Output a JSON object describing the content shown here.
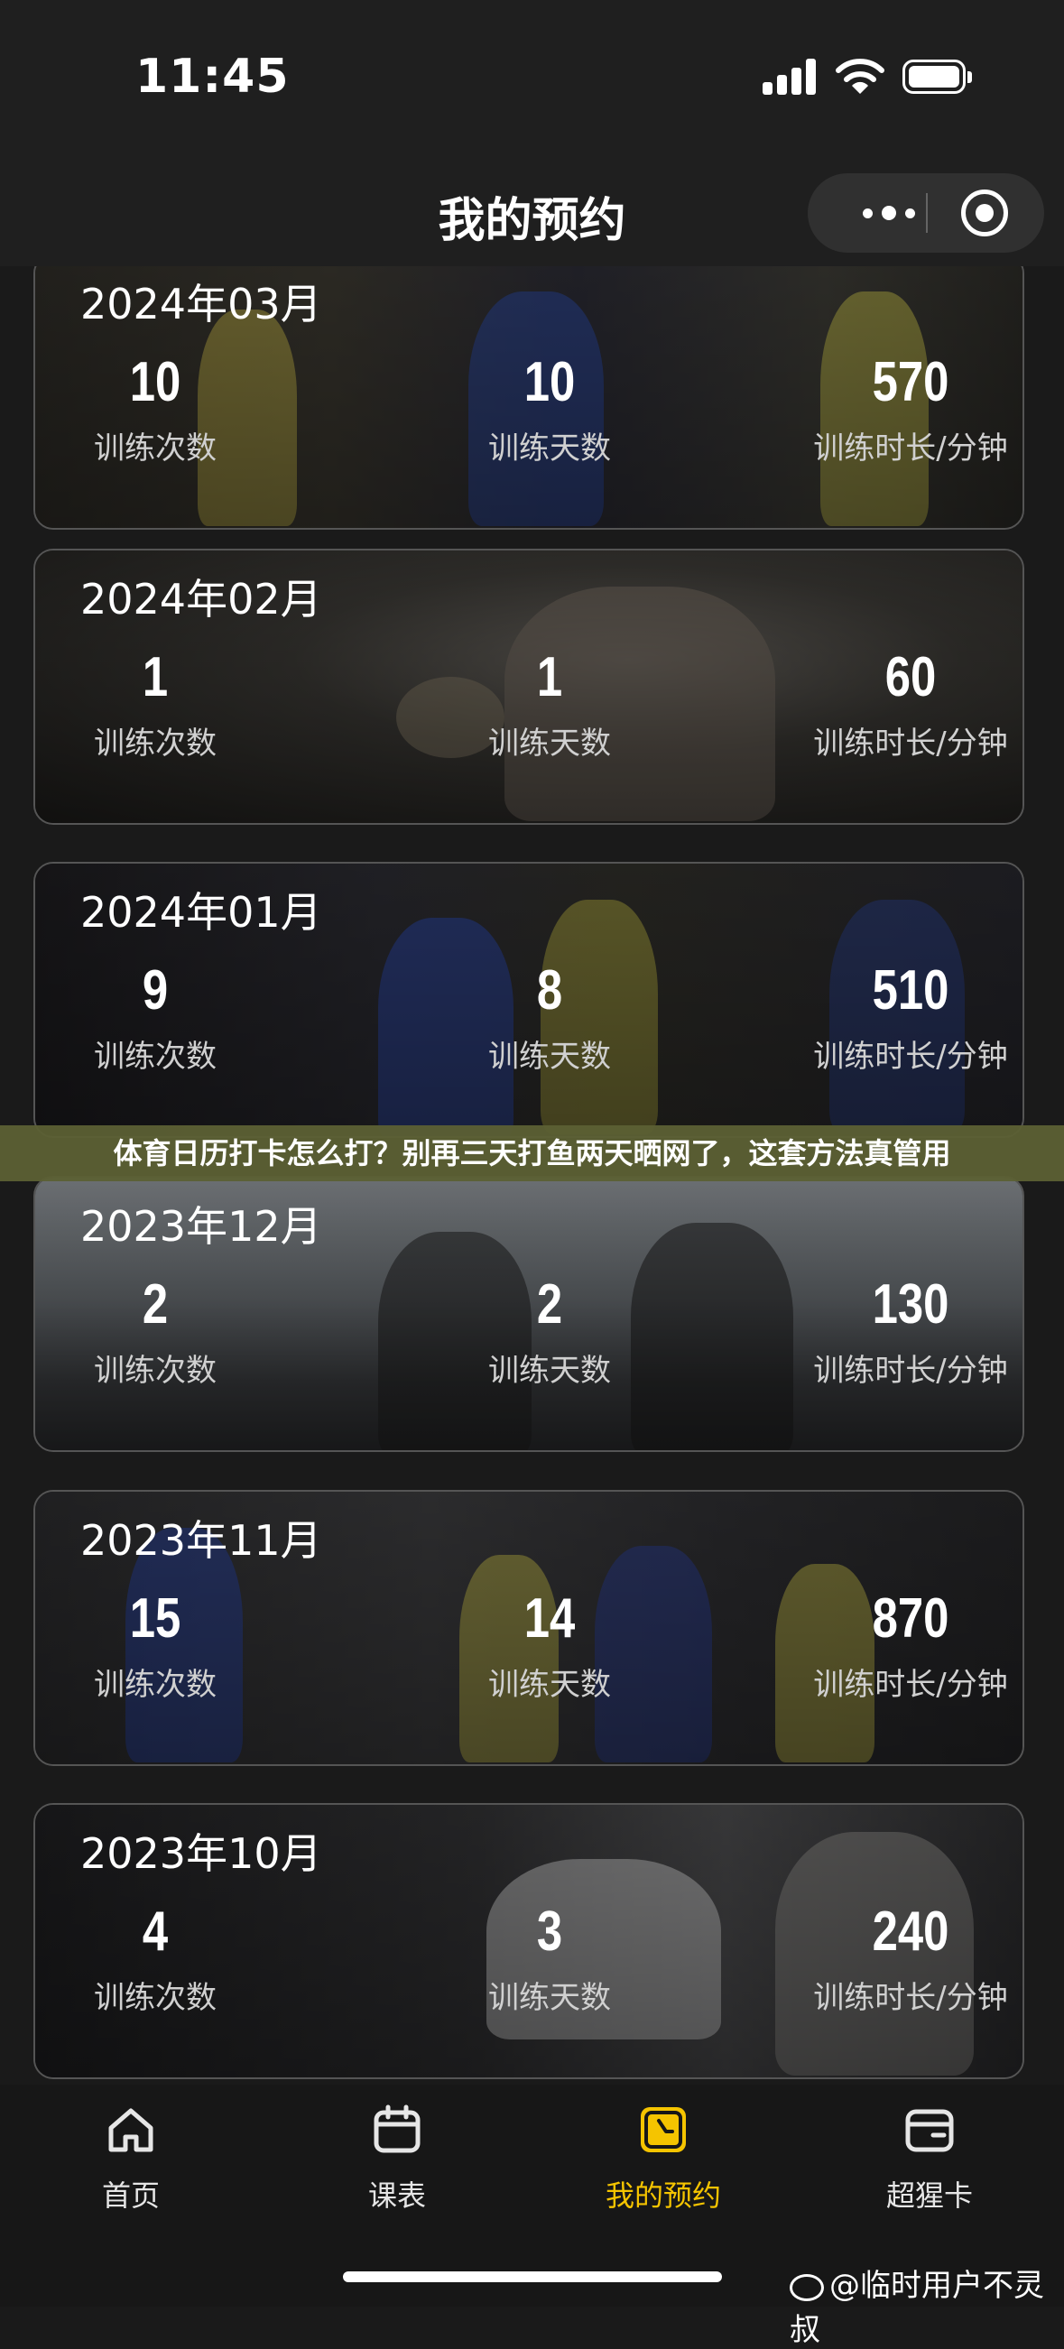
{
  "status_bar": {
    "time": "11:45"
  },
  "nav": {
    "title": "我的预约"
  },
  "stat_labels": {
    "count": "训练次数",
    "days": "训练天数",
    "duration": "训练时长/分钟"
  },
  "cards": [
    {
      "month": "2024年03月",
      "count": "10",
      "days": "10",
      "duration": "570"
    },
    {
      "month": "2024年02月",
      "count": "1",
      "days": "1",
      "duration": "60"
    },
    {
      "month": "2024年01月",
      "count": "9",
      "days": "8",
      "duration": "510"
    },
    {
      "month": "2023年12月",
      "count": "2",
      "days": "2",
      "duration": "130"
    },
    {
      "month": "2023年11月",
      "count": "15",
      "days": "14",
      "duration": "870"
    },
    {
      "month": "2023年10月",
      "count": "4",
      "days": "3",
      "duration": "240"
    }
  ],
  "banner": {
    "text": "体育日历打卡怎么打？别再三天打鱼两天晒网了，这套方法真管用"
  },
  "tabs": [
    {
      "label": "首页",
      "icon": "home-icon"
    },
    {
      "label": "课表",
      "icon": "calendar-icon"
    },
    {
      "label": "我的预约",
      "icon": "clock-icon"
    },
    {
      "label": "超猩卡",
      "icon": "wallet-icon"
    }
  ],
  "colors": {
    "accent": "#f5c400",
    "background": "#1a1a1a"
  },
  "watermark": {
    "text": "@临时用户不灵叔"
  }
}
